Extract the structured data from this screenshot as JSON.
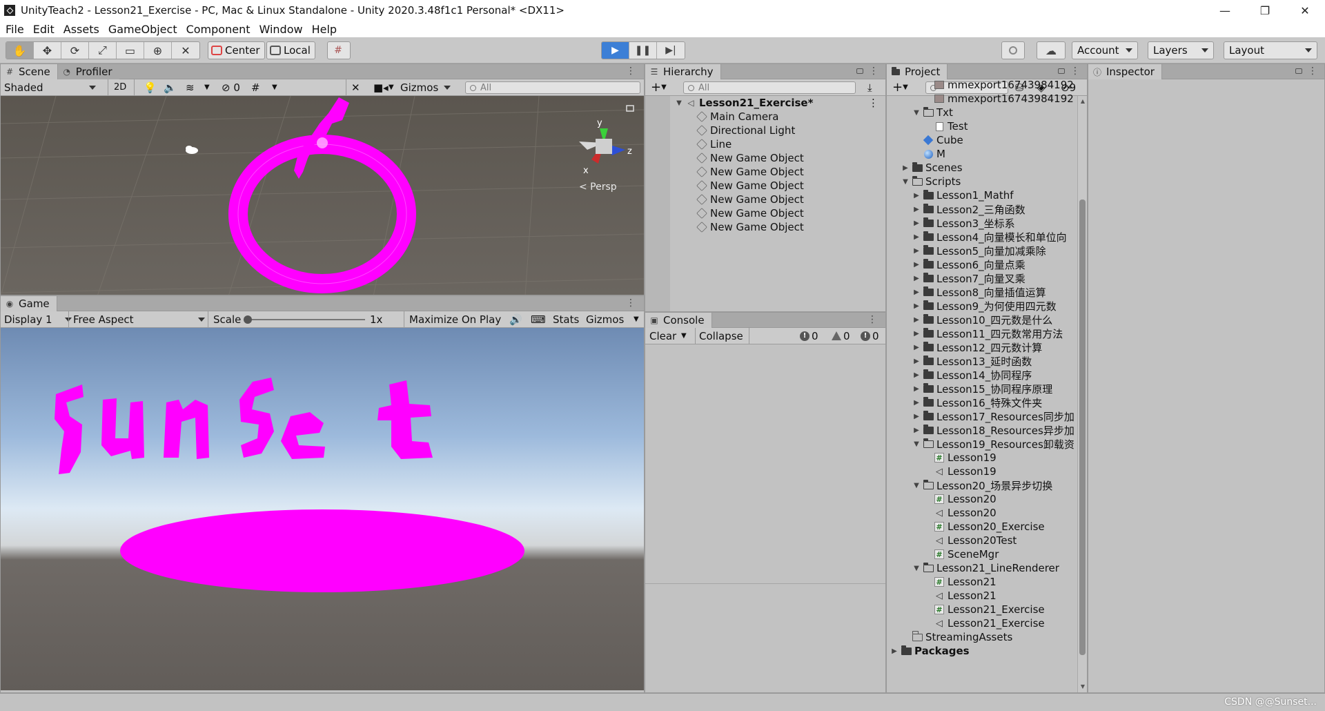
{
  "window": {
    "title": "UnityTeach2 - Lesson21_Exercise - PC, Mac & Linux Standalone - Unity 2020.3.48f1c1 Personal* <DX11>",
    "controls": [
      "—",
      "❐",
      "✕"
    ]
  },
  "menu": [
    "File",
    "Edit",
    "Assets",
    "GameObject",
    "Component",
    "Window",
    "Help"
  ],
  "toolbar": {
    "pivot_label": "Center",
    "space_label": "Local",
    "account_label": "Account",
    "layers_label": "Layers",
    "layout_label": "Layout",
    "accent_color": "#3c7fd6"
  },
  "scene": {
    "tabs": [
      "Scene",
      "Profiler"
    ],
    "shading": "Shaded",
    "mode_2d": "2D",
    "hidden_count": "0",
    "gizmos": "Gizmos",
    "search_placeholder": "All",
    "persp_label": "< Persp",
    "axis_x": "x",
    "axis_y": "y",
    "axis_z": "z"
  },
  "game": {
    "tab": "Game",
    "display": "Display 1",
    "aspect": "Free Aspect",
    "scale_label": "Scale",
    "scale_value": "1x",
    "maximize": "Maximize On Play",
    "stats": "Stats",
    "gizmos": "Gizmos",
    "drawing_color": "#ff00ff"
  },
  "hierarchy": {
    "tab": "Hierarchy",
    "search_placeholder": "All",
    "scene_name": "Lesson21_Exercise*",
    "items": [
      "Main Camera",
      "Directional Light",
      "Line",
      "New Game Object",
      "New Game Object",
      "New Game Object",
      "New Game Object",
      "New Game Object",
      "New Game Object"
    ]
  },
  "console": {
    "tab": "Console",
    "clear": "Clear",
    "collapse": "Collapse",
    "logs": "0",
    "warnings": "0",
    "errors": "0"
  },
  "project": {
    "tab": "Project",
    "hidden_count": "9",
    "items": [
      {
        "label": "mmexport16743984192",
        "depth": 3,
        "arrow": "",
        "icon": "image"
      },
      {
        "label": "mmexport16743984192",
        "depth": 3,
        "arrow": "",
        "icon": "image"
      },
      {
        "label": "Txt",
        "depth": 2,
        "arrow": "open",
        "icon": "folder-open"
      },
      {
        "label": "Test",
        "depth": 3,
        "arrow": "",
        "icon": "text"
      },
      {
        "label": "Cube",
        "depth": 2,
        "arrow": "",
        "icon": "prefab"
      },
      {
        "label": "M",
        "depth": 2,
        "arrow": "",
        "icon": "material"
      },
      {
        "label": "Scenes",
        "depth": 1,
        "arrow": "closed",
        "icon": "folder"
      },
      {
        "label": "Scripts",
        "depth": 1,
        "arrow": "open",
        "icon": "folder-open"
      },
      {
        "label": "Lesson1_Mathf",
        "depth": 2,
        "arrow": "closed",
        "icon": "folder"
      },
      {
        "label": "Lesson2_三角函数",
        "depth": 2,
        "arrow": "closed",
        "icon": "folder"
      },
      {
        "label": "Lesson3_坐标系",
        "depth": 2,
        "arrow": "closed",
        "icon": "folder"
      },
      {
        "label": "Lesson4_向量模长和单位向",
        "depth": 2,
        "arrow": "closed",
        "icon": "folder"
      },
      {
        "label": "Lesson5_向量加减乘除",
        "depth": 2,
        "arrow": "closed",
        "icon": "folder"
      },
      {
        "label": "Lesson6_向量点乘",
        "depth": 2,
        "arrow": "closed",
        "icon": "folder"
      },
      {
        "label": "Lesson7_向量叉乘",
        "depth": 2,
        "arrow": "closed",
        "icon": "folder"
      },
      {
        "label": "Lesson8_向量插值运算",
        "depth": 2,
        "arrow": "closed",
        "icon": "folder"
      },
      {
        "label": "Lesson9_为何使用四元数",
        "depth": 2,
        "arrow": "closed",
        "icon": "folder"
      },
      {
        "label": "Lesson10_四元数是什么",
        "depth": 2,
        "arrow": "closed",
        "icon": "folder"
      },
      {
        "label": "Lesson11_四元数常用方法",
        "depth": 2,
        "arrow": "closed",
        "icon": "folder"
      },
      {
        "label": "Lesson12_四元数计算",
        "depth": 2,
        "arrow": "closed",
        "icon": "folder"
      },
      {
        "label": "Lesson13_延时函数",
        "depth": 2,
        "arrow": "closed",
        "icon": "folder"
      },
      {
        "label": "Lesson14_协同程序",
        "depth": 2,
        "arrow": "closed",
        "icon": "folder"
      },
      {
        "label": "Lesson15_协同程序原理",
        "depth": 2,
        "arrow": "closed",
        "icon": "folder"
      },
      {
        "label": "Lesson16_特殊文件夹",
        "depth": 2,
        "arrow": "closed",
        "icon": "folder"
      },
      {
        "label": "Lesson17_Resources同步加",
        "depth": 2,
        "arrow": "closed",
        "icon": "folder"
      },
      {
        "label": "Lesson18_Resources异步加",
        "depth": 2,
        "arrow": "closed",
        "icon": "folder"
      },
      {
        "label": "Lesson19_Resources卸载资",
        "depth": 2,
        "arrow": "open",
        "icon": "folder-open"
      },
      {
        "label": "Lesson19",
        "depth": 3,
        "arrow": "",
        "icon": "script"
      },
      {
        "label": "Lesson19",
        "depth": 3,
        "arrow": "",
        "icon": "scene"
      },
      {
        "label": "Lesson20_场景异步切换",
        "depth": 2,
        "arrow": "open",
        "icon": "folder-open"
      },
      {
        "label": "Lesson20",
        "depth": 3,
        "arrow": "",
        "icon": "script"
      },
      {
        "label": "Lesson20",
        "depth": 3,
        "arrow": "",
        "icon": "scene"
      },
      {
        "label": "Lesson20_Exercise",
        "depth": 3,
        "arrow": "",
        "icon": "script"
      },
      {
        "label": "Lesson20Test",
        "depth": 3,
        "arrow": "",
        "icon": "scene"
      },
      {
        "label": "SceneMgr",
        "depth": 3,
        "arrow": "",
        "icon": "script"
      },
      {
        "label": "Lesson21_LineRenderer",
        "depth": 2,
        "arrow": "open",
        "icon": "folder-open"
      },
      {
        "label": "Lesson21",
        "depth": 3,
        "arrow": "",
        "icon": "script"
      },
      {
        "label": "Lesson21",
        "depth": 3,
        "arrow": "",
        "icon": "scene"
      },
      {
        "label": "Lesson21_Exercise",
        "depth": 3,
        "arrow": "",
        "icon": "script"
      },
      {
        "label": "Lesson21_Exercise",
        "depth": 3,
        "arrow": "",
        "icon": "scene"
      },
      {
        "label": "StreamingAssets",
        "depth": 1,
        "arrow": "",
        "icon": "folder-empty"
      },
      {
        "label": "Packages",
        "depth": 0,
        "arrow": "closed",
        "icon": "folder",
        "bold": true
      }
    ]
  },
  "inspector": {
    "tab": "Inspector"
  },
  "watermark": "CSDN @@Sunset..."
}
